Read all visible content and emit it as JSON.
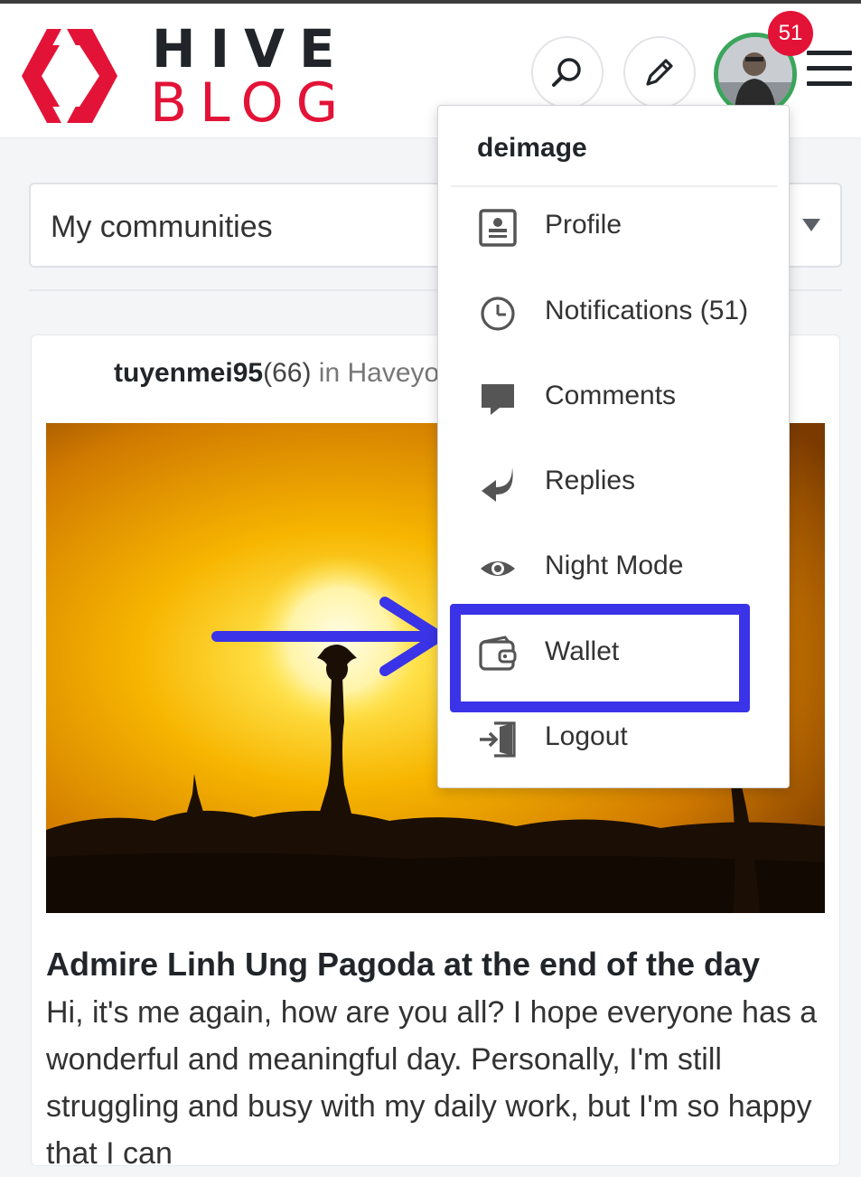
{
  "header": {
    "logo_line1": "HIVE",
    "logo_line2": "BLOG",
    "brand_color": "#e31337",
    "notification_count": "51"
  },
  "feed": {
    "communities_select": "My communities",
    "post": {
      "author": "tuyenmei95",
      "reputation": "(66)",
      "in_label": "in",
      "community": "Haveyo",
      "title": "Admire Linh Ung Pagoda at the end of the day",
      "excerpt": "Hi, it's me again, how are you all? I hope everyone has a wonderful and meaningful day. Personally, I'm still struggling and busy with my daily work, but I'm so happy that I can"
    }
  },
  "user_menu": {
    "username": "deimage",
    "items": [
      {
        "label": "Profile",
        "icon": "profile-card-icon"
      },
      {
        "label": "Notifications (51)",
        "icon": "clock-icon"
      },
      {
        "label": "Comments",
        "icon": "comment-bubble-icon"
      },
      {
        "label": "Replies",
        "icon": "reply-arrow-icon"
      },
      {
        "label": "Night Mode",
        "icon": "eye-icon"
      },
      {
        "label": "Wallet",
        "icon": "wallet-icon"
      },
      {
        "label": "Logout",
        "icon": "logout-icon"
      }
    ]
  },
  "annotation": {
    "highlight_color": "#3a33e8"
  }
}
